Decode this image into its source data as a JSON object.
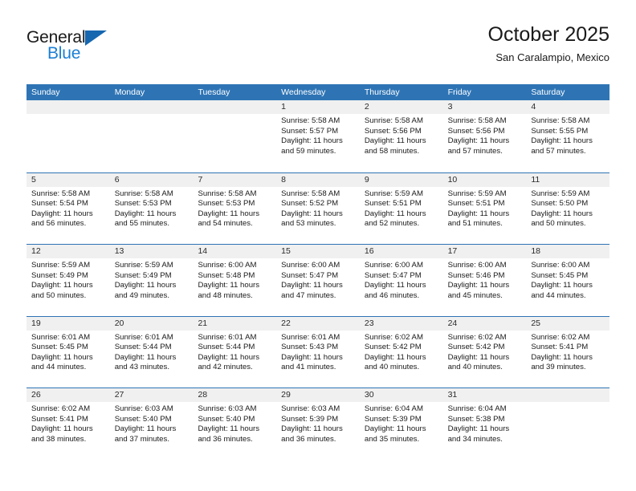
{
  "brand": {
    "name_part1": "General",
    "name_part2": "Blue",
    "accent_color": "#1b7fd4",
    "triangle_color": "#1567b0"
  },
  "header": {
    "title": "October 2025",
    "subtitle": "San Caralampio, Mexico"
  },
  "theme": {
    "header_blue": "#2e74b5",
    "day_band_gray": "#f0f0f0",
    "text_dark": "#1a1a1a"
  },
  "weekdays": [
    "Sunday",
    "Monday",
    "Tuesday",
    "Wednesday",
    "Thursday",
    "Friday",
    "Saturday"
  ],
  "weeks": [
    {
      "days": [
        {
          "number": "",
          "lines": []
        },
        {
          "number": "",
          "lines": []
        },
        {
          "number": "",
          "lines": []
        },
        {
          "number": "1",
          "lines": [
            "Sunrise: 5:58 AM",
            "Sunset: 5:57 PM",
            "Daylight: 11 hours",
            "and 59 minutes."
          ]
        },
        {
          "number": "2",
          "lines": [
            "Sunrise: 5:58 AM",
            "Sunset: 5:56 PM",
            "Daylight: 11 hours",
            "and 58 minutes."
          ]
        },
        {
          "number": "3",
          "lines": [
            "Sunrise: 5:58 AM",
            "Sunset: 5:56 PM",
            "Daylight: 11 hours",
            "and 57 minutes."
          ]
        },
        {
          "number": "4",
          "lines": [
            "Sunrise: 5:58 AM",
            "Sunset: 5:55 PM",
            "Daylight: 11 hours",
            "and 57 minutes."
          ]
        }
      ]
    },
    {
      "days": [
        {
          "number": "5",
          "lines": [
            "Sunrise: 5:58 AM",
            "Sunset: 5:54 PM",
            "Daylight: 11 hours",
            "and 56 minutes."
          ]
        },
        {
          "number": "6",
          "lines": [
            "Sunrise: 5:58 AM",
            "Sunset: 5:53 PM",
            "Daylight: 11 hours",
            "and 55 minutes."
          ]
        },
        {
          "number": "7",
          "lines": [
            "Sunrise: 5:58 AM",
            "Sunset: 5:53 PM",
            "Daylight: 11 hours",
            "and 54 minutes."
          ]
        },
        {
          "number": "8",
          "lines": [
            "Sunrise: 5:58 AM",
            "Sunset: 5:52 PM",
            "Daylight: 11 hours",
            "and 53 minutes."
          ]
        },
        {
          "number": "9",
          "lines": [
            "Sunrise: 5:59 AM",
            "Sunset: 5:51 PM",
            "Daylight: 11 hours",
            "and 52 minutes."
          ]
        },
        {
          "number": "10",
          "lines": [
            "Sunrise: 5:59 AM",
            "Sunset: 5:51 PM",
            "Daylight: 11 hours",
            "and 51 minutes."
          ]
        },
        {
          "number": "11",
          "lines": [
            "Sunrise: 5:59 AM",
            "Sunset: 5:50 PM",
            "Daylight: 11 hours",
            "and 50 minutes."
          ]
        }
      ]
    },
    {
      "days": [
        {
          "number": "12",
          "lines": [
            "Sunrise: 5:59 AM",
            "Sunset: 5:49 PM",
            "Daylight: 11 hours",
            "and 50 minutes."
          ]
        },
        {
          "number": "13",
          "lines": [
            "Sunrise: 5:59 AM",
            "Sunset: 5:49 PM",
            "Daylight: 11 hours",
            "and 49 minutes."
          ]
        },
        {
          "number": "14",
          "lines": [
            "Sunrise: 6:00 AM",
            "Sunset: 5:48 PM",
            "Daylight: 11 hours",
            "and 48 minutes."
          ]
        },
        {
          "number": "15",
          "lines": [
            "Sunrise: 6:00 AM",
            "Sunset: 5:47 PM",
            "Daylight: 11 hours",
            "and 47 minutes."
          ]
        },
        {
          "number": "16",
          "lines": [
            "Sunrise: 6:00 AM",
            "Sunset: 5:47 PM",
            "Daylight: 11 hours",
            "and 46 minutes."
          ]
        },
        {
          "number": "17",
          "lines": [
            "Sunrise: 6:00 AM",
            "Sunset: 5:46 PM",
            "Daylight: 11 hours",
            "and 45 minutes."
          ]
        },
        {
          "number": "18",
          "lines": [
            "Sunrise: 6:00 AM",
            "Sunset: 5:45 PM",
            "Daylight: 11 hours",
            "and 44 minutes."
          ]
        }
      ]
    },
    {
      "days": [
        {
          "number": "19",
          "lines": [
            "Sunrise: 6:01 AM",
            "Sunset: 5:45 PM",
            "Daylight: 11 hours",
            "and 44 minutes."
          ]
        },
        {
          "number": "20",
          "lines": [
            "Sunrise: 6:01 AM",
            "Sunset: 5:44 PM",
            "Daylight: 11 hours",
            "and 43 minutes."
          ]
        },
        {
          "number": "21",
          "lines": [
            "Sunrise: 6:01 AM",
            "Sunset: 5:44 PM",
            "Daylight: 11 hours",
            "and 42 minutes."
          ]
        },
        {
          "number": "22",
          "lines": [
            "Sunrise: 6:01 AM",
            "Sunset: 5:43 PM",
            "Daylight: 11 hours",
            "and 41 minutes."
          ]
        },
        {
          "number": "23",
          "lines": [
            "Sunrise: 6:02 AM",
            "Sunset: 5:42 PM",
            "Daylight: 11 hours",
            "and 40 minutes."
          ]
        },
        {
          "number": "24",
          "lines": [
            "Sunrise: 6:02 AM",
            "Sunset: 5:42 PM",
            "Daylight: 11 hours",
            "and 40 minutes."
          ]
        },
        {
          "number": "25",
          "lines": [
            "Sunrise: 6:02 AM",
            "Sunset: 5:41 PM",
            "Daylight: 11 hours",
            "and 39 minutes."
          ]
        }
      ]
    },
    {
      "days": [
        {
          "number": "26",
          "lines": [
            "Sunrise: 6:02 AM",
            "Sunset: 5:41 PM",
            "Daylight: 11 hours",
            "and 38 minutes."
          ]
        },
        {
          "number": "27",
          "lines": [
            "Sunrise: 6:03 AM",
            "Sunset: 5:40 PM",
            "Daylight: 11 hours",
            "and 37 minutes."
          ]
        },
        {
          "number": "28",
          "lines": [
            "Sunrise: 6:03 AM",
            "Sunset: 5:40 PM",
            "Daylight: 11 hours",
            "and 36 minutes."
          ]
        },
        {
          "number": "29",
          "lines": [
            "Sunrise: 6:03 AM",
            "Sunset: 5:39 PM",
            "Daylight: 11 hours",
            "and 36 minutes."
          ]
        },
        {
          "number": "30",
          "lines": [
            "Sunrise: 6:04 AM",
            "Sunset: 5:39 PM",
            "Daylight: 11 hours",
            "and 35 minutes."
          ]
        },
        {
          "number": "31",
          "lines": [
            "Sunrise: 6:04 AM",
            "Sunset: 5:38 PM",
            "Daylight: 11 hours",
            "and 34 minutes."
          ]
        },
        {
          "number": "",
          "lines": []
        }
      ]
    }
  ]
}
